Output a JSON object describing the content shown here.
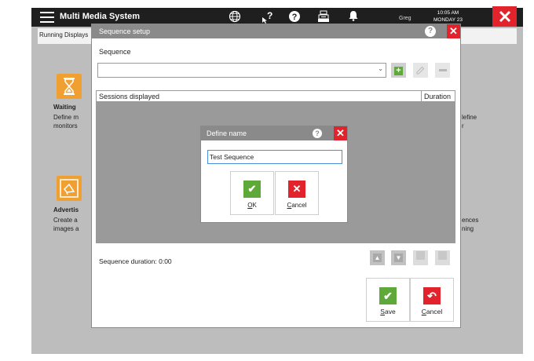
{
  "app": {
    "title": "Multi Media System",
    "user": "Greg",
    "time": "10:05 AM",
    "day": "MONDAY 23",
    "colors": {
      "topbar": "#1f1f1f",
      "accent_red": "#e2232b",
      "green": "#5fa83a",
      "orange": "#f0a030"
    }
  },
  "topbar_icons": [
    "menu-icon",
    "globe-icon",
    "pointer-help-icon",
    "help-icon",
    "cash-register-icon",
    "bell-icon",
    "close-icon"
  ],
  "background": {
    "tab": "Running Displays",
    "waiting_title": "Waiting",
    "waiting_desc_1": "Define m",
    "waiting_desc_2": "monitors",
    "right_desc_1": "lefine",
    "right_desc_2": "r",
    "advert_title": "Advertis",
    "advert_desc_1": "Create a",
    "advert_desc_2": "images a",
    "right2_desc_1": "ences",
    "right2_desc_2": "ning"
  },
  "sequence_dialog": {
    "title": "Sequence setup",
    "sequence_label": "Sequence",
    "sequence_value": "",
    "col_sessions": "Sessions displayed",
    "col_duration": "Duration",
    "duration_label": "Sequence duration:",
    "duration_value": "0:00",
    "save_rest": "ave",
    "save_underline": "S",
    "cancel_rest": "ancel",
    "cancel_underline": "C"
  },
  "define_name_dialog": {
    "title": "Define name",
    "input_value": "Test Sequence",
    "ok_underline": "O",
    "ok_rest": "K",
    "cancel_underline": "C",
    "cancel_rest": "ancel"
  }
}
